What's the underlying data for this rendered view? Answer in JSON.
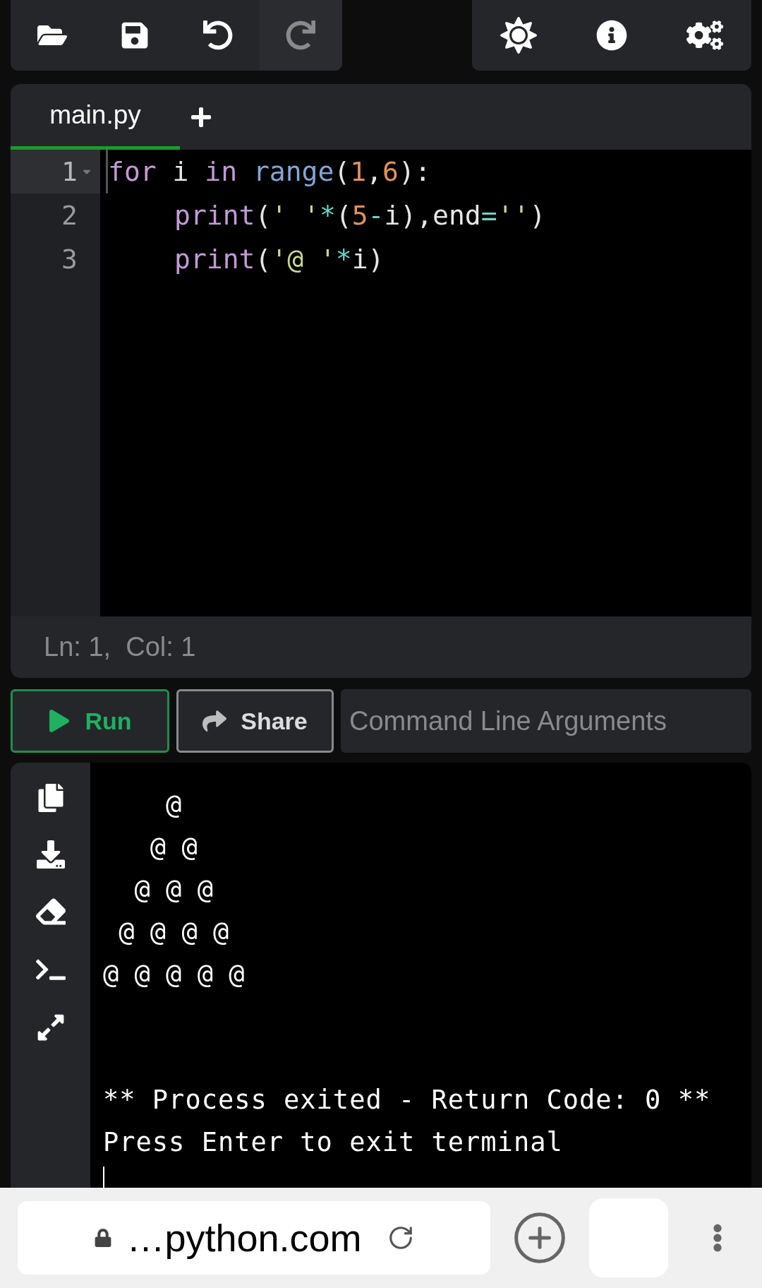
{
  "file_toolbar": [
    {
      "disabled": false
    },
    {
      "disabled": false
    },
    {
      "disabled": false
    },
    {
      "disabled": true
    }
  ],
  "tabs": [
    {
      "label": "main.py",
      "selected": true
    }
  ],
  "editor": {
    "lines": [
      {
        "number": "1",
        "active": true,
        "tokens": [
          {
            "text": "for",
            "kind": "keyword"
          },
          {
            "text": " i ",
            "kind": "plain"
          },
          {
            "text": "in",
            "kind": "keyword"
          },
          {
            "text": " range",
            "kind": "builtin"
          },
          {
            "text": "(",
            "kind": "plain"
          },
          {
            "text": "1",
            "kind": "number"
          },
          {
            "text": ",",
            "kind": "plain"
          },
          {
            "text": "6",
            "kind": "number"
          },
          {
            "text": "):",
            "kind": "plain"
          }
        ]
      },
      {
        "number": "2",
        "active": false,
        "indented": true,
        "tokens": [
          {
            "text": "print",
            "kind": "keyword"
          },
          {
            "text": "(",
            "kind": "plain"
          },
          {
            "text": "' '",
            "kind": "string"
          },
          {
            "text": "*",
            "kind": "operator"
          },
          {
            "text": "(",
            "kind": "plain"
          },
          {
            "text": "5",
            "kind": "number"
          },
          {
            "text": "-",
            "kind": "operator"
          },
          {
            "text": "i),end",
            "kind": "plain"
          },
          {
            "text": "=",
            "kind": "operator"
          },
          {
            "text": "''",
            "kind": "string"
          },
          {
            "text": ")",
            "kind": "plain"
          }
        ]
      },
      {
        "number": "3",
        "active": false,
        "indented": true,
        "tokens": [
          {
            "text": "print",
            "kind": "keyword"
          },
          {
            "text": "(",
            "kind": "plain"
          },
          {
            "text": "'@ '",
            "kind": "string"
          },
          {
            "text": "*",
            "kind": "operator"
          },
          {
            "text": "i)",
            "kind": "plain"
          }
        ]
      }
    ],
    "status": "Ln: 1,  Col: 1"
  },
  "run_button": "Run",
  "share_button": "Share",
  "arguments_field": {
    "placeholder": "Command Line Arguments"
  },
  "terminal": {
    "output": [
      "    @ ",
      "   @ @ ",
      "  @ @ @ ",
      " @ @ @ @ ",
      "@ @ @ @ @ "
    ],
    "messages": [
      "** Process exited - Return Code: 0 **",
      "Press Enter to exit terminal"
    ]
  },
  "browser": {
    "url": "…python.com"
  }
}
